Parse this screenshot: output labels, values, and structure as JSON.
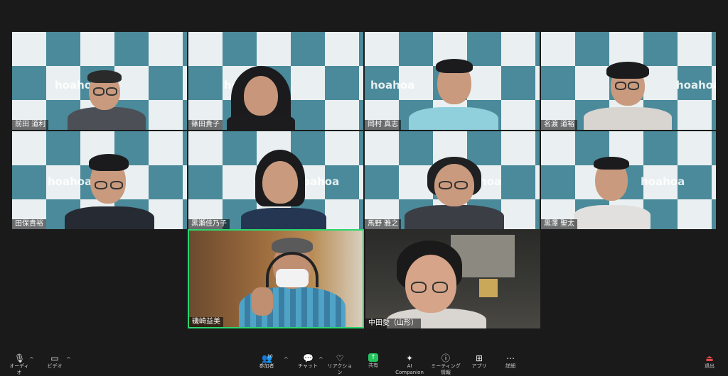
{
  "participants_grid": [
    {
      "name": "前田 道利"
    },
    {
      "name": "篠田貴子"
    },
    {
      "name": "岡村 真志"
    },
    {
      "name": "名渡 道裕"
    },
    {
      "name": "田保貴裕"
    },
    {
      "name": "黒瀬佳乃子"
    },
    {
      "name": "馬野 雅之"
    },
    {
      "name": "黒澤 聖太"
    }
  ],
  "video_tiles": [
    {
      "name": "磯崎益美"
    },
    {
      "name": "中田愛（山形）"
    }
  ],
  "background_words": {
    "logo": "hoahoa",
    "logo_mirrored": "hoahoa"
  },
  "toolbar": {
    "audio": "オーディオ",
    "video": "ビデオ",
    "participants": "参加者",
    "participants_count": "10",
    "chat": "チャット",
    "reactions": "リアクション",
    "share": "共有",
    "ai_companion": "AI Companion",
    "meeting_info": "ミーティング情報",
    "apps": "アプリ",
    "more": "詳細",
    "leave": "退出"
  }
}
